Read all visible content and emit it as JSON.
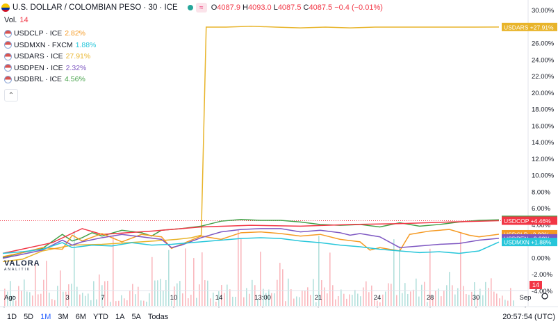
{
  "header": {
    "title": "U.S. DOLLAR / COLOMBIAN PESO · 30 · ICE",
    "o_label": "O",
    "o_value": "4087.9",
    "h_label": "H",
    "h_value": "4093.0",
    "l_label": "L",
    "l_value": "4087.5",
    "c_label": "C",
    "c_value": "4087.5",
    "change": "−0.4 (−0.01%)",
    "pill_symbol": "≈"
  },
  "volume": {
    "label": "Vol.",
    "value": "14"
  },
  "legend": [
    {
      "name": "USDCLP · ICE",
      "value": "2.82%",
      "color": "#f59a23"
    },
    {
      "name": "USDMXN · FXCM",
      "value": "1.88%",
      "color": "#26c6da"
    },
    {
      "name": "USDARS · ICE",
      "value": "27.91%",
      "color": "#e8b42a"
    },
    {
      "name": "USDPEN · ICE",
      "value": "2.32%",
      "color": "#7e57c2"
    },
    {
      "name": "USDBRL · ICE",
      "value": "4.56%",
      "color": "#43a047"
    }
  ],
  "logo": {
    "name": "VALORA",
    "sub": "ANALITIK"
  },
  "bottom": {
    "timeframes": [
      "1D",
      "5D",
      "1M",
      "3M",
      "6M",
      "YTD",
      "1A",
      "5A",
      "Todas"
    ],
    "active": "1M",
    "clock": "20:57:54 (UTC)"
  },
  "chart_data": {
    "type": "line",
    "ylabel_unit": "%",
    "ylim": [
      -4,
      30
    ],
    "yticks": [
      "30.00%",
      "28.00%",
      "26.00%",
      "24.00%",
      "22.00%",
      "20.00%",
      "18.00%",
      "16.00%",
      "14.00%",
      "12.00%",
      "10.00%",
      "8.00%",
      "6.00%",
      "4.00%",
      "2.00%",
      "0.00%",
      "-2.00%",
      "-4.00%"
    ],
    "xticks": [
      "Ago",
      "3",
      "7",
      "10",
      "14",
      "13:00",
      "21",
      "24",
      "28",
      "30",
      "Sep"
    ],
    "series": [
      {
        "name": "USDARS",
        "color": "#e8b42a",
        "end_label": "+27.91%",
        "points": [
          [
            0,
            -0.5
          ],
          [
            4,
            -0.2
          ],
          [
            8,
            0.8
          ],
          [
            14,
            1.5
          ],
          [
            20,
            1.6
          ],
          [
            28,
            1.9
          ],
          [
            33,
            2.1
          ],
          [
            35,
            2.2
          ],
          [
            38,
            2.4
          ],
          [
            40,
            2.7
          ],
          [
            41,
            27.9
          ],
          [
            45,
            27.9
          ],
          [
            50,
            28.0
          ],
          [
            55,
            27.9
          ],
          [
            60,
            27.8
          ],
          [
            65,
            27.9
          ],
          [
            70,
            27.8
          ],
          [
            75,
            27.9
          ],
          [
            80,
            27.9
          ],
          [
            85,
            27.9
          ],
          [
            90,
            27.9
          ],
          [
            95,
            27.9
          ],
          [
            100,
            27.91
          ]
        ]
      },
      {
        "name": "USDBRL",
        "color": "#43a047",
        "end_label": "+4.56%",
        "points": [
          [
            0,
            0.0
          ],
          [
            4,
            0.6
          ],
          [
            8,
            1.1
          ],
          [
            12,
            2.8
          ],
          [
            14,
            2.0
          ],
          [
            16,
            2.4
          ],
          [
            18,
            3.0
          ],
          [
            20,
            2.6
          ],
          [
            24,
            3.3
          ],
          [
            28,
            3.0
          ],
          [
            30,
            2.6
          ],
          [
            32,
            3.3
          ],
          [
            36,
            3.5
          ],
          [
            40,
            3.8
          ],
          [
            44,
            4.4
          ],
          [
            48,
            4.6
          ],
          [
            52,
            4.5
          ],
          [
            56,
            4.5
          ],
          [
            60,
            4.3
          ],
          [
            64,
            4.0
          ],
          [
            68,
            3.9
          ],
          [
            72,
            4.0
          ],
          [
            76,
            3.7
          ],
          [
            80,
            4.2
          ],
          [
            84,
            3.8
          ],
          [
            88,
            4.0
          ],
          [
            92,
            4.3
          ],
          [
            96,
            4.5
          ],
          [
            100,
            4.56
          ]
        ]
      },
      {
        "name": "USDCOP",
        "color": "#f23645",
        "end_label": "+4.46%",
        "points": [
          [
            0,
            0.5
          ],
          [
            10,
            1.8
          ],
          [
            16,
            3.5
          ],
          [
            20,
            2.8
          ],
          [
            30,
            3.2
          ],
          [
            40,
            3.7
          ],
          [
            50,
            3.9
          ],
          [
            60,
            3.8
          ],
          [
            70,
            4.0
          ],
          [
            80,
            4.1
          ],
          [
            90,
            4.3
          ],
          [
            100,
            4.46
          ]
        ]
      },
      {
        "name": "USDCLP",
        "color": "#f59a23",
        "end_label": "+2.82%",
        "points": [
          [
            0,
            0.1
          ],
          [
            4,
            0.6
          ],
          [
            8,
            1.2
          ],
          [
            12,
            1.0
          ],
          [
            14,
            2.7
          ],
          [
            16,
            2.0
          ],
          [
            20,
            2.9
          ],
          [
            24,
            1.9
          ],
          [
            28,
            2.8
          ],
          [
            32,
            2.5
          ],
          [
            34,
            1.1
          ],
          [
            36,
            1.6
          ],
          [
            40,
            2.6
          ],
          [
            44,
            2.2
          ],
          [
            48,
            3.0
          ],
          [
            52,
            3.1
          ],
          [
            56,
            2.9
          ],
          [
            60,
            2.6
          ],
          [
            64,
            2.8
          ],
          [
            68,
            2.2
          ],
          [
            72,
            1.9
          ],
          [
            74,
            0.9
          ],
          [
            76,
            1.2
          ],
          [
            80,
            0.8
          ],
          [
            82,
            2.8
          ],
          [
            86,
            3.2
          ],
          [
            90,
            3.4
          ],
          [
            94,
            2.7
          ],
          [
            96,
            2.5
          ],
          [
            100,
            2.82
          ]
        ]
      },
      {
        "name": "USDPEN",
        "color": "#7e57c2",
        "end_label": "+2.32%",
        "points": [
          [
            0,
            -0.1
          ],
          [
            4,
            0.4
          ],
          [
            8,
            0.9
          ],
          [
            12,
            2.1
          ],
          [
            14,
            1.5
          ],
          [
            16,
            1.9
          ],
          [
            20,
            2.4
          ],
          [
            24,
            2.8
          ],
          [
            28,
            2.5
          ],
          [
            32,
            2.2
          ],
          [
            34,
            1.2
          ],
          [
            36,
            1.5
          ],
          [
            40,
            2.4
          ],
          [
            44,
            3.1
          ],
          [
            48,
            3.4
          ],
          [
            52,
            3.5
          ],
          [
            56,
            3.5
          ],
          [
            60,
            3.1
          ],
          [
            64,
            3.3
          ],
          [
            68,
            3.0
          ],
          [
            70,
            2.7
          ],
          [
            72,
            2.9
          ],
          [
            76,
            2.5
          ],
          [
            80,
            1.2
          ],
          [
            84,
            1.4
          ],
          [
            88,
            1.6
          ],
          [
            92,
            1.7
          ],
          [
            96,
            2.1
          ],
          [
            100,
            2.32
          ]
        ]
      },
      {
        "name": "USDMXN",
        "color": "#26c6da",
        "end_label": "+1.88%",
        "points": [
          [
            0,
            0.5
          ],
          [
            4,
            0.7
          ],
          [
            8,
            1.0
          ],
          [
            12,
            1.8
          ],
          [
            14,
            1.2
          ],
          [
            18,
            1.5
          ],
          [
            22,
            1.4
          ],
          [
            26,
            1.8
          ],
          [
            30,
            1.5
          ],
          [
            34,
            1.6
          ],
          [
            40,
            1.9
          ],
          [
            44,
            2.1
          ],
          [
            48,
            2.3
          ],
          [
            52,
            2.4
          ],
          [
            56,
            2.3
          ],
          [
            60,
            2.0
          ],
          [
            64,
            1.8
          ],
          [
            68,
            1.5
          ],
          [
            72,
            1.3
          ],
          [
            76,
            1.0
          ],
          [
            80,
            0.8
          ],
          [
            84,
            0.6
          ],
          [
            88,
            0.7
          ],
          [
            92,
            0.5
          ],
          [
            96,
            0.8
          ],
          [
            100,
            1.88
          ]
        ]
      }
    ]
  }
}
